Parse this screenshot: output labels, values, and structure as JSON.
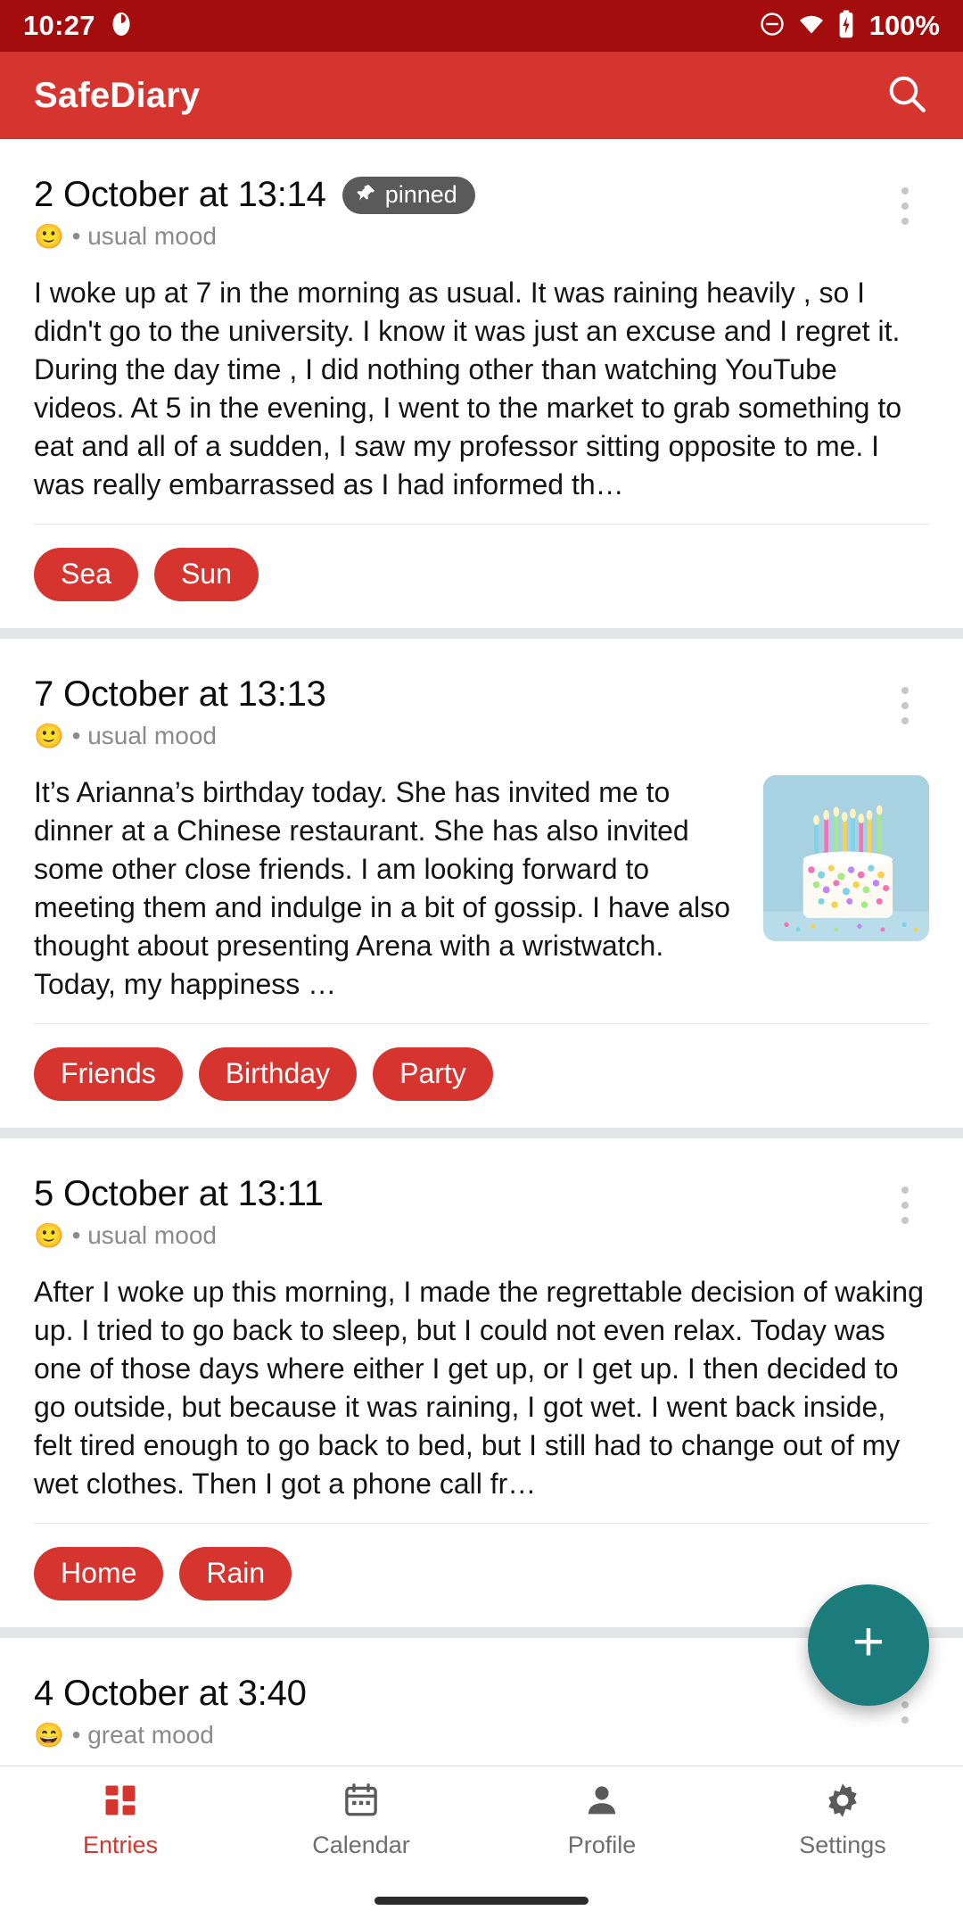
{
  "statusbar": {
    "time": "10:27",
    "battery_percent": "100%",
    "icons": [
      "app-notification-icon",
      "do-not-disturb-icon",
      "wifi-icon",
      "battery-icon"
    ],
    "background": "#A30D0D"
  },
  "appbar": {
    "title": "SafeDiary",
    "search_icon": "search-icon",
    "background": "#D6342F"
  },
  "theme": {
    "accent": "#D6342F",
    "fab": "#1C7B7B",
    "pin_badge": "#5A5A5A",
    "muted_text": "#8A8A8A"
  },
  "entries": [
    {
      "date": "2 October at 13:14",
      "pinned": true,
      "pinned_label": "pinned",
      "mood_emoji": "🙂",
      "mood_text": "• usual mood",
      "body": "I woke up at 7 in the morning as usual. It was raining heavily , so I didn't go to the university. I know it was just an excuse and I regret it. During the day time , I did nothing other than watching YouTube videos. At 5 in the evening, I went to the market to grab something to eat and all of a sudden, I saw my professor sitting opposite to me. I was really embarrassed as I had informed th…",
      "has_image": false,
      "tags": [
        "Sea",
        "Sun"
      ]
    },
    {
      "date": "7 October at 13:13",
      "pinned": false,
      "pinned_label": "",
      "mood_emoji": "🙂",
      "mood_text": "• usual mood",
      "body": "It’s Arianna’s birthday today. She has invited me to dinner at a Chinese restaurant. She has also invited some other close friends. I am looking forward to meeting them and indulge in a bit of gossip. I have also thought about presenting Arena with a wristwatch. Today, my happiness …",
      "has_image": true,
      "image_name": "birthday-cake-photo",
      "tags": [
        "Friends",
        "Birthday",
        "Party"
      ]
    },
    {
      "date": "5 October at 13:11",
      "pinned": false,
      "pinned_label": "",
      "mood_emoji": "🙂",
      "mood_text": "• usual mood",
      "body": "After I woke up this morning, I made the regrettable decision of waking up. I tried to go back to sleep, but I could not even relax. Today was one of those days where either I get up, or I get up. I then decided to go outside, but because it was raining, I got wet. I went back inside, felt tired enough to go back to bed, but I still had to change out of my wet clothes. Then I got a phone call fr…",
      "has_image": false,
      "tags": [
        "Home",
        "Rain"
      ]
    },
    {
      "date": "4 October at 3:40",
      "pinned": false,
      "pinned_label": "",
      "mood_emoji": "😄",
      "mood_text": "• great mood",
      "body": "",
      "has_image": false,
      "tags": []
    }
  ],
  "fab": {
    "label": "+",
    "icon": "plus-icon"
  },
  "bottomnav": {
    "items": [
      {
        "label": "Entries",
        "icon": "grid-entries-icon",
        "active": true
      },
      {
        "label": "Calendar",
        "icon": "calendar-icon",
        "active": false
      },
      {
        "label": "Profile",
        "icon": "person-icon",
        "active": false
      },
      {
        "label": "Settings",
        "icon": "gear-icon",
        "active": false
      }
    ]
  }
}
